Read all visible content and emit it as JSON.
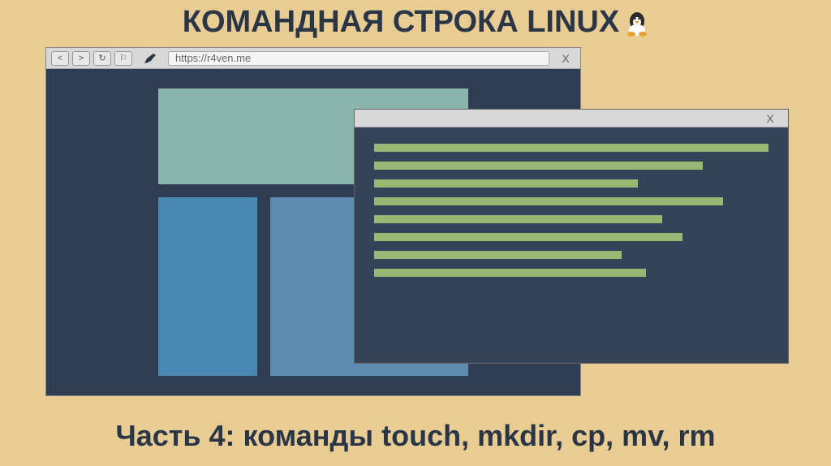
{
  "title": "КОМАНДНАЯ СТРОКА LINUX",
  "subtitle": "Часть 4: команды touch, mkdir, cp, mv, rm",
  "browser": {
    "nav_back": "<",
    "nav_forward": ">",
    "nav_refresh": "↻",
    "nav_bookmark": "⚐",
    "url": "https://r4ven.me",
    "close": "X"
  },
  "terminal": {
    "close": "X",
    "line_widths": [
      370,
      405,
      325,
      430,
      355,
      380,
      305,
      335
    ]
  },
  "colors": {
    "bg": "#e8cc93",
    "panel_dark": "#2f3d53",
    "terminal_dark": "#354359",
    "teal": "#8ab5ad",
    "blue1": "#4888b3",
    "blue2": "#5c8ab0",
    "green": "#97b872"
  }
}
